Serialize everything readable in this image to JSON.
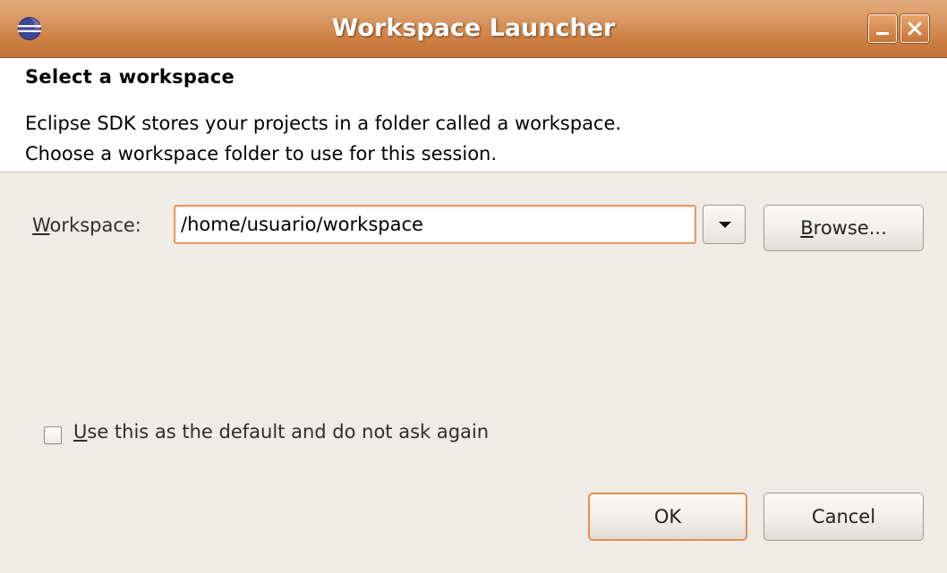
{
  "window": {
    "title": "Workspace Launcher",
    "icon": "eclipse-icon",
    "controls": {
      "minimize_icon": "minimize-icon",
      "close_icon": "close-icon"
    },
    "accent_color": "#d08445"
  },
  "header": {
    "title": "Select a workspace",
    "description_line1": "Eclipse SDK stores your projects in a folder called a workspace.",
    "description_line2": "Choose a workspace folder to use for this session."
  },
  "workspace": {
    "label_mnemonic": "W",
    "label_rest": "orkspace:",
    "value": "/home/usuario/workspace",
    "dropdown_icon": "chevron-down-icon",
    "browse_mnemonic": "B",
    "browse_rest": "rowse..."
  },
  "default_checkbox": {
    "checked": false,
    "label_mnemonic": "U",
    "label_rest": "se this as the default and do not ask again"
  },
  "buttons": {
    "ok": "OK",
    "cancel": "Cancel"
  }
}
